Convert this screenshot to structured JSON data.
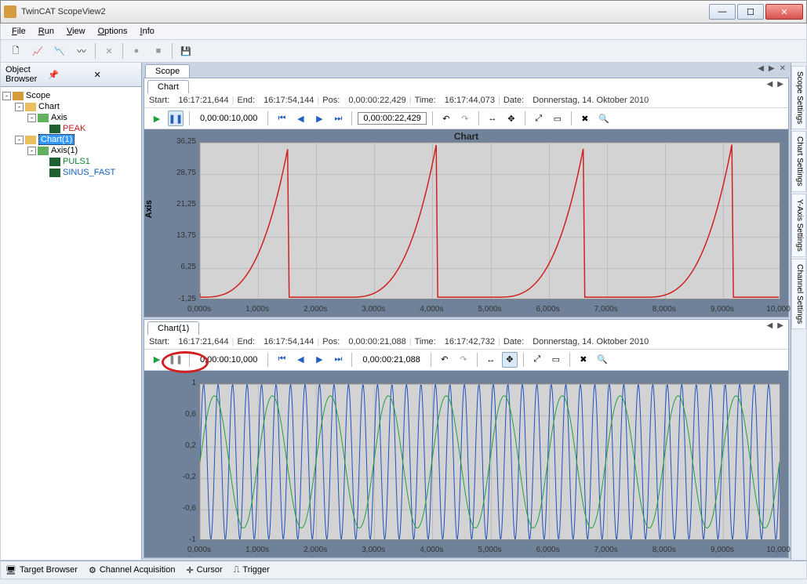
{
  "window": {
    "title": "TwinCAT ScopeView2"
  },
  "menu": {
    "file": "File",
    "run": "Run",
    "view": "View",
    "options": "Options",
    "info": "Info"
  },
  "object_browser": {
    "title": "Object Browser",
    "root": "Scope",
    "chart_a": "Chart",
    "axis_a": "Axis",
    "peak": "PEAK",
    "chart_b": "Chart(1)",
    "axis_b": "Axis(1)",
    "puls1": "PULS1",
    "sinus": "SINUS_FAST"
  },
  "scope_tab": "Scope",
  "chart1": {
    "tab": "Chart",
    "start_lbl": "Start:",
    "start": "16:17:21,644",
    "end_lbl": "End:",
    "end": "16:17:54,144",
    "pos_lbl": "Pos:",
    "pos": "0,00:00:22,429",
    "time_lbl": "Time:",
    "time": "16:17:44,073",
    "date_lbl": "Date:",
    "date": "Donnerstag, 14. Oktober 2010",
    "window": "0,00:00:10,000",
    "pos_box": "0,00:00:22,429",
    "title": "Chart",
    "ylabel": "Axis",
    "yticks": [
      "36,25",
      "28,75",
      "21,25",
      "13,75",
      "6,25",
      "-1,25"
    ],
    "xticks": [
      "0,000s",
      "1,000s",
      "2,000s",
      "3,000s",
      "4,000s",
      "5,000s",
      "6,000s",
      "7,000s",
      "8,000s",
      "9,000s",
      "10,000s"
    ]
  },
  "chart2": {
    "tab": "Chart(1)",
    "start_lbl": "Start:",
    "start": "16:17:21,644",
    "end_lbl": "End:",
    "end": "16:17:54,144",
    "pos_lbl": "Pos:",
    "pos": "0,00:00:21,088",
    "time_lbl": "Time:",
    "time": "16:17:42,732",
    "date_lbl": "Date:",
    "date": "Donnerstag, 14. Oktober 2010",
    "window": "0,00:00:10,000",
    "pos_box": "0,00:00:21,088",
    "yticks": [
      "1",
      "0,6",
      "0,2",
      "-0,2",
      "-0,6",
      "-1"
    ],
    "xticks": [
      "0,000s",
      "1,000s",
      "2,000s",
      "3,000s",
      "4,000s",
      "5,000s",
      "6,000s",
      "7,000s",
      "8,000s",
      "9,000s",
      "10,000s"
    ]
  },
  "side": {
    "scope": "Scope Settings",
    "chart": "Chart Settings",
    "yaxis": "Y-Axis Settings",
    "channel": "Channel Settings"
  },
  "status": {
    "target": "Target Browser",
    "channel": "Channel Acquisition",
    "cursor": "Cursor",
    "trigger": "Trigger"
  },
  "chart_data": [
    {
      "type": "line",
      "title": "Chart",
      "ylabel": "Axis",
      "xlim": [
        0,
        10
      ],
      "ylim": [
        -1.25,
        36.25
      ],
      "series": [
        {
          "name": "PEAK",
          "color": "#d02020",
          "x_period": 2.55,
          "description": "sawtooth ramp to ~36 then drop to ~-1, 4 pulses visible"
        }
      ]
    },
    {
      "type": "line",
      "title": "Chart(1)",
      "xlim": [
        0,
        10
      ],
      "ylim": [
        -1,
        1
      ],
      "series": [
        {
          "name": "PULS1",
          "color": "#2050c0",
          "freq_hz": 4.0,
          "amplitude": 1.0
        },
        {
          "name": "SINUS_FAST",
          "color": "#20a040",
          "freq_hz": 1.0,
          "amplitude": 0.85
        }
      ]
    }
  ]
}
